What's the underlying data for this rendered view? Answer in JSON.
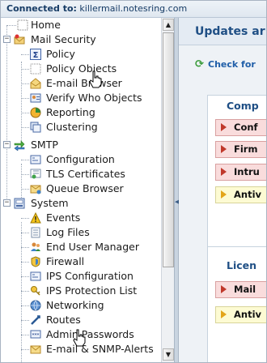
{
  "topbar": {
    "label": "Connected to:",
    "host": "killermail.notesring.com"
  },
  "tree": {
    "items": [
      {
        "label": "Home",
        "icon": "home-icon"
      },
      {
        "label": "Mail Security",
        "icon": "mail-security-folder-icon"
      },
      {
        "label": "Policy",
        "icon": "policy-sigma-icon"
      },
      {
        "label": "Policy Objects",
        "icon": "policy-objects-icon"
      },
      {
        "label": "E-mail Browser",
        "icon": "email-browser-icon"
      },
      {
        "label": "Verify Who Objects",
        "icon": "verify-who-icon"
      },
      {
        "label": "Reporting",
        "icon": "reporting-pie-icon"
      },
      {
        "label": "Clustering",
        "icon": "clustering-icon"
      },
      {
        "label": "SMTP",
        "icon": "smtp-arrows-icon"
      },
      {
        "label": "Configuration",
        "icon": "configuration-icon"
      },
      {
        "label": "TLS Certificates",
        "icon": "tls-certificates-icon"
      },
      {
        "label": "Queue Browser",
        "icon": "queue-browser-icon"
      },
      {
        "label": "System",
        "icon": "system-icon"
      },
      {
        "label": "Events",
        "icon": "events-warning-icon"
      },
      {
        "label": "Log Files",
        "icon": "log-files-icon"
      },
      {
        "label": "End User Manager",
        "icon": "end-user-manager-icon"
      },
      {
        "label": "Firewall",
        "icon": "firewall-icon"
      },
      {
        "label": "IPS Configuration",
        "icon": "ips-configuration-icon"
      },
      {
        "label": "IPS Protection List",
        "icon": "ips-protection-list-icon"
      },
      {
        "label": "Networking",
        "icon": "networking-icon"
      },
      {
        "label": "Routes",
        "icon": "routes-icon"
      },
      {
        "label": "Admin Passwords",
        "icon": "admin-passwords-icon"
      },
      {
        "label": "E-mail & SNMP-Alerts",
        "icon": "email-snmp-alerts-icon"
      }
    ]
  },
  "right": {
    "title": "Updates ar",
    "check_link": "Check for",
    "box1": {
      "heading": "Comp",
      "items": [
        "Conf",
        "Firm",
        "Intru",
        "Antiv"
      ]
    },
    "box2": {
      "heading": "Licen",
      "items": [
        "Mail",
        "Antiv"
      ]
    }
  },
  "colors": {
    "accent": "#1f4f85",
    "red_item": "#f9dcdc",
    "yellow_item": "#fdfbd3"
  }
}
